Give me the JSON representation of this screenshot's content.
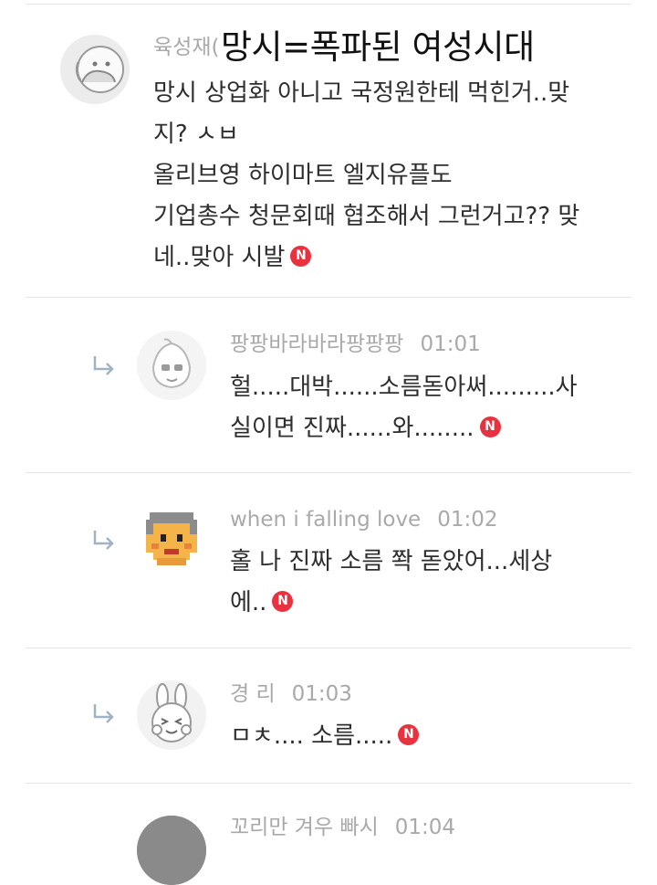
{
  "overlay_title": "망시=폭파된 여성시대",
  "comments": [
    {
      "author": "육성재(",
      "time": "",
      "lines": [
        "망시 상업화 아니고 국정원한테 먹힌거..맞",
        "지? ㅅㅂ",
        "올리브영 하이마트 엘지유플도",
        "기업총수 청문회때 협조해서 그런거고?? 맞",
        "네..맞아 시발"
      ],
      "badge": "N",
      "avatar_icon": "line-drawn-face-avatar-icon"
    },
    {
      "author": "팡팡바라바라팡팡팡",
      "time": "01:01",
      "lines": [
        "헐.....대박......소름돋아써.........사",
        "실이면 진짜......와........"
      ],
      "badge": "N",
      "avatar_icon": "peach-character-avatar-icon"
    },
    {
      "author": "when i falling love",
      "time": "01:02",
      "lines": [
        "홀 나 진짜 소름 쫙 돋았어...세상",
        "에.."
      ],
      "badge": "N",
      "avatar_icon": "pixel-face-avatar-icon"
    },
    {
      "author": "경 리",
      "time": "01:03",
      "lines": [
        "ㅁㅊ.... 소름....."
      ],
      "badge": "N",
      "avatar_icon": "rabbit-face-avatar-icon"
    },
    {
      "author": "꼬리만 겨우 빠시",
      "time": "01:04",
      "lines": [],
      "badge": "",
      "avatar_icon": "partial-avatar-icon"
    }
  ],
  "icons": {
    "reply": "reply-arrow-icon",
    "new_badge": "new-badge-icon"
  },
  "colors": {
    "badge_red": "#e8323f",
    "meta_gray": "#a9a9a9",
    "divider": "#e6e6e6",
    "reply_arrow": "#9fb3c4"
  }
}
